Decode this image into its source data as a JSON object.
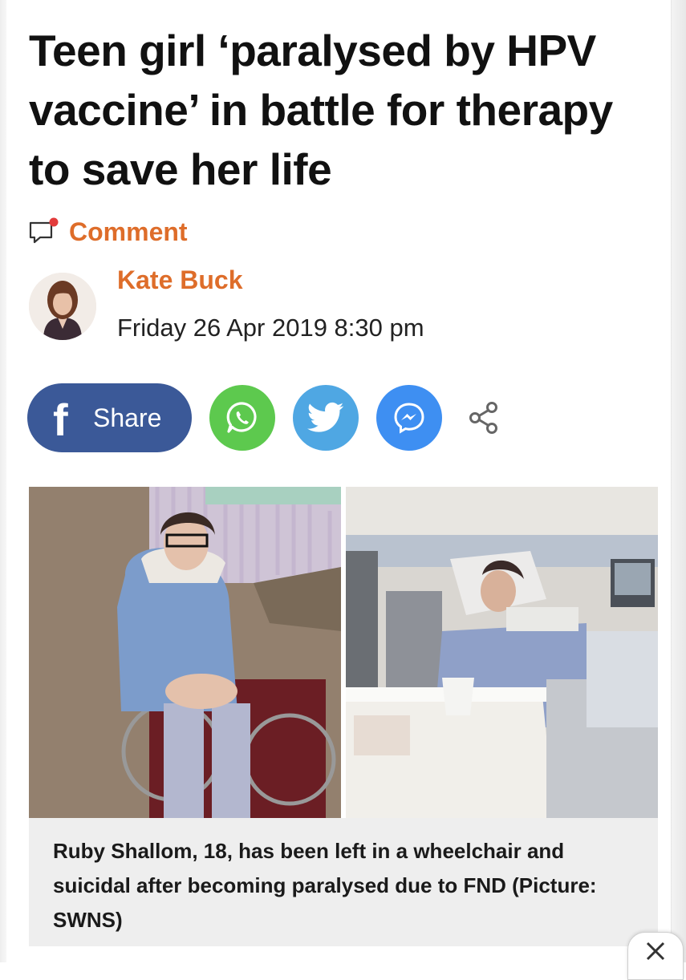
{
  "article": {
    "headline": "Teen girl ‘paralysed by HPV vaccine’ in battle for therapy to save her life",
    "comment_label": "Comment",
    "author": "Kate Buck",
    "date": "Friday 26 Apr 2019 8:30 pm"
  },
  "share": {
    "facebook_label": "Share",
    "buttons": [
      "whatsapp-icon",
      "twitter-icon",
      "messenger-icon",
      "share-icon"
    ]
  },
  "image": {
    "caption": "Ruby Shallom, 18, has been left in a wheelchair and suicidal after becoming paralysed due to FND (Picture: SWNS)"
  },
  "colors": {
    "accent_orange": "#de6d2a",
    "facebook": "#3b5998",
    "whatsapp": "#5dc94e",
    "twitter": "#4fa7e3",
    "messenger": "#3e8ff2",
    "caption_bg": "#eeeeee"
  }
}
